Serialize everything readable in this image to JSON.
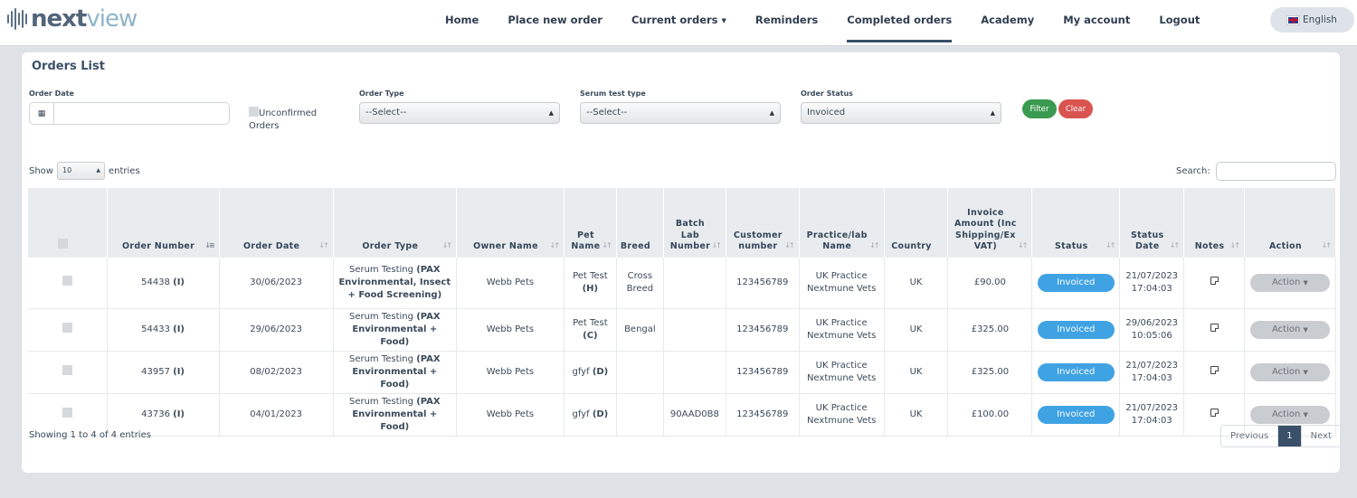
{
  "header": {
    "logo_next": "next",
    "logo_view": "view",
    "nav": [
      {
        "label": "Home"
      },
      {
        "label": "Place new order"
      },
      {
        "label": "Current orders"
      },
      {
        "label": "Reminders"
      },
      {
        "label": "Completed orders"
      },
      {
        "label": "Academy"
      },
      {
        "label": "My account"
      },
      {
        "label": "Logout"
      }
    ],
    "active_nav": "Completed orders",
    "language": "English"
  },
  "card": {
    "title": "Orders List"
  },
  "filters": {
    "order_date_label": "Order Date",
    "order_date_value": "",
    "unconfirmed_label": "Unconfirmed Orders",
    "order_type_label": "Order Type",
    "order_type_value": "--Select--",
    "serum_label": "Serum test type",
    "serum_value": "--Select--",
    "status_label": "Order Status",
    "status_value": "Invoiced",
    "filter_button": "Filter",
    "clear_button": "Clear"
  },
  "length": {
    "show": "Show",
    "value": "10",
    "entries": "entries"
  },
  "search": {
    "label": "Search:",
    "value": ""
  },
  "table": {
    "headers": {
      "order_number": "Order Number",
      "order_date": "Order Date",
      "order_type": "Order Type",
      "owner_name": "Owner Name",
      "pet_name": "Pet Name",
      "breed": "Breed",
      "batch": "Batch Lab Number",
      "customer": "Customer number",
      "practice": "Practice/lab Name",
      "country": "Country",
      "invoice": "Invoice Amount (Inc Shipping/Ex VAT)",
      "status": "Status",
      "status_date": "Status Date",
      "notes": "Notes",
      "action": "Action"
    },
    "rows": [
      {
        "order_number": "54438",
        "order_flag": "(I)",
        "order_date": "30/06/2023",
        "type_prefix": "Serum Testing",
        "type_detail": "(PAX Environmental, Insect + Food Screening)",
        "owner": "Webb Pets",
        "pet": "Pet Test",
        "pet_flag": "(H)",
        "breed": "Cross Breed",
        "batch": "",
        "customer": "123456789",
        "practice": "UK Practice Nextmune Vets",
        "country": "UK",
        "amount": "£90.00",
        "status": "Invoiced",
        "status_date": "21/07/2023",
        "status_time": "17:04:03",
        "action": "Action"
      },
      {
        "order_number": "54433",
        "order_flag": "(I)",
        "order_date": "29/06/2023",
        "type_prefix": "Serum Testing",
        "type_detail": "(PAX Environmental + Food)",
        "owner": "Webb Pets",
        "pet": "Pet Test",
        "pet_flag": "(C)",
        "breed": "Bengal",
        "batch": "",
        "customer": "123456789",
        "practice": "UK Practice Nextmune Vets",
        "country": "UK",
        "amount": "£325.00",
        "status": "Invoiced",
        "status_date": "29/06/2023",
        "status_time": "10:05:06",
        "action": "Action"
      },
      {
        "order_number": "43957",
        "order_flag": "(I)",
        "order_date": "08/02/2023",
        "type_prefix": "Serum Testing",
        "type_detail": "(PAX Environmental + Food)",
        "owner": "Webb Pets",
        "pet": "gfyf",
        "pet_flag": "(D)",
        "breed": "",
        "batch": "",
        "customer": "123456789",
        "practice": "UK Practice Nextmune Vets",
        "country": "UK",
        "amount": "£325.00",
        "status": "Invoiced",
        "status_date": "21/07/2023",
        "status_time": "17:04:03",
        "action": "Action"
      },
      {
        "order_number": "43736",
        "order_flag": "(I)",
        "order_date": "04/01/2023",
        "type_prefix": "Serum Testing",
        "type_detail": "(PAX Environmental + Food)",
        "owner": "Webb Pets",
        "pet": "gfyf",
        "pet_flag": "(D)",
        "breed": "",
        "batch": "90AAD0B8",
        "customer": "123456789",
        "practice": "UK Practice Nextmune Vets",
        "country": "UK",
        "amount": "£100.00",
        "status": "Invoiced",
        "status_date": "21/07/2023",
        "status_time": "17:04:03",
        "action": "Action"
      }
    ]
  },
  "footer": {
    "info": "Showing 1 to 4 of 4 entries",
    "previous": "Previous",
    "page": "1",
    "next": "Next"
  },
  "colors": {
    "status_badge": "#3fa2e3",
    "filter_button": "#3a9a4f",
    "clear_button": "#d9534f",
    "active_page": "#3a5068"
  }
}
